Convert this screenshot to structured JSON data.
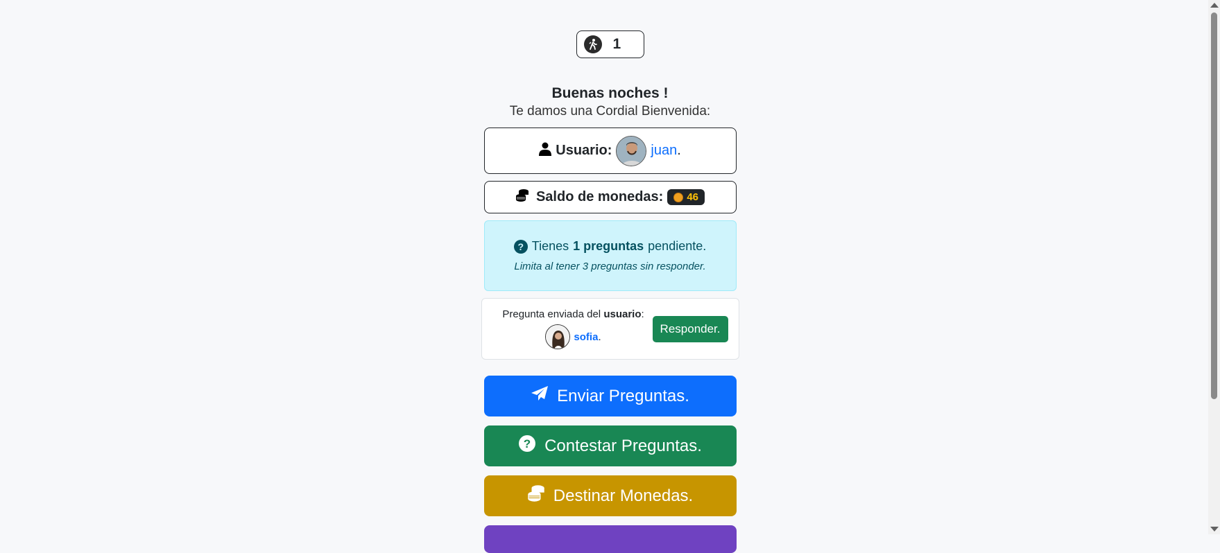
{
  "level": {
    "value": "1",
    "icon": "hiker-icon"
  },
  "greeting": {
    "title": "Buenas noches !",
    "subtitle": "Te damos una Cordial Bienvenida:"
  },
  "user": {
    "label": "Usuario:",
    "name": "juan",
    "suffix": "."
  },
  "coins": {
    "label": "Saldo de monedas:",
    "amount": "46"
  },
  "pending": {
    "prefix": "Tienes",
    "count_text": "1 preguntas",
    "suffix": "pendiente.",
    "note": "Limita al tener 3 preguntas sin responder."
  },
  "question": {
    "sent_by_prefix": "Pregunta enviada del",
    "sent_by_strong": "usuario",
    "sent_by_colon": ":",
    "username": "sofia",
    "username_suffix": ".",
    "respond_label": "Responder."
  },
  "actions": {
    "send": "Enviar Preguntas.",
    "answer": "Contestar Preguntas.",
    "assign": "Destinar Monedas."
  },
  "colors": {
    "primary": "#0d6efd",
    "success": "#198754",
    "gold": "#c79500",
    "purple": "#6f42c1",
    "info_bg": "#cff4fc"
  }
}
